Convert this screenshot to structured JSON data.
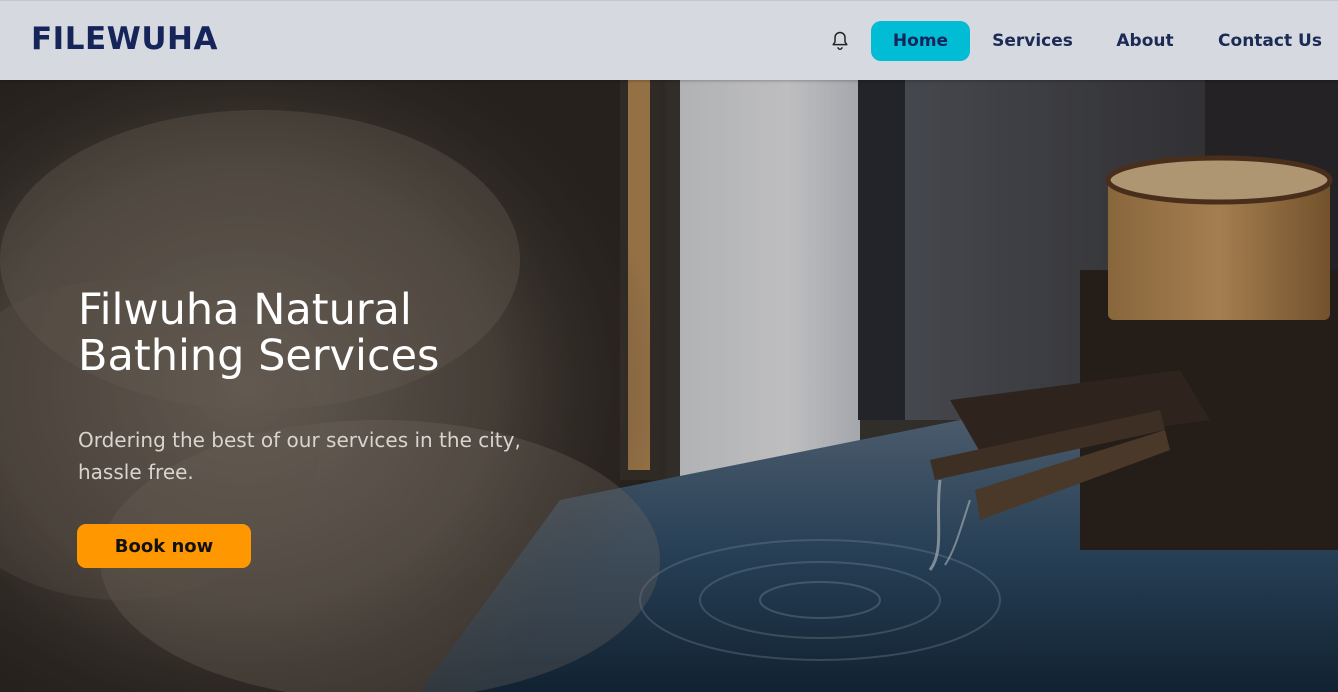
{
  "header": {
    "brand": "FILEWUHA",
    "nav": {
      "home": "Home",
      "services": "Services",
      "about": "About",
      "contact": "Contact Us"
    },
    "icons": {
      "notification": "bell-icon"
    },
    "active_color": "#00bcd4",
    "brand_color": "#15255a"
  },
  "hero": {
    "title_line1": "Filwuha Natural",
    "title_line2": "Bathing Services",
    "subtitle_line1": "Ordering the best of our services in the city,",
    "subtitle_line2": "hassle free.",
    "cta": "Book now",
    "cta_color": "#ff9800"
  }
}
